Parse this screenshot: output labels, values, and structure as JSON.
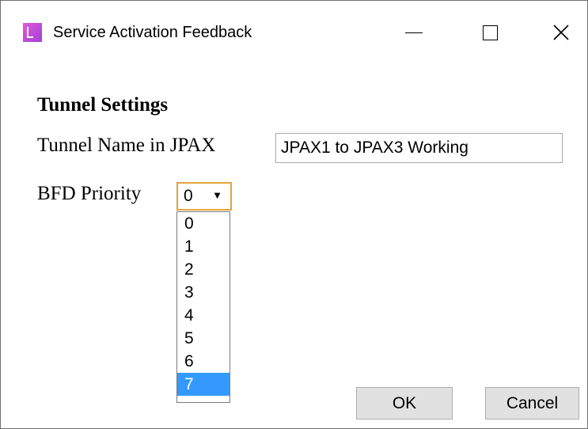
{
  "window": {
    "title": "Service Activation Feedback",
    "controls": {
      "minimize": "minimize",
      "maximize": "maximize",
      "close": "✕"
    }
  },
  "section": {
    "title": "Tunnel Settings"
  },
  "fields": {
    "tunnel_name_label": "Tunnel Name in JPAX",
    "tunnel_name_value": "JPAX1 to JPAX3 Working",
    "bfd_priority_label": "BFD Priority",
    "bfd_priority_value": "0",
    "bfd_arrow": "▼"
  },
  "dropdown": {
    "options": [
      "0",
      "1",
      "2",
      "3",
      "4",
      "5",
      "6",
      "7"
    ],
    "highlighted": "7"
  },
  "buttons": {
    "ok": "OK",
    "cancel": "Cancel"
  },
  "colors": {
    "focus_border": "#e3a33b",
    "highlight": "#3399ff"
  }
}
